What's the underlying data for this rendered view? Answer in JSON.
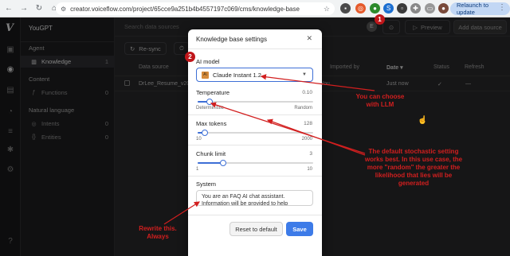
{
  "browser": {
    "url": "creator.voiceflow.com/project/65cce9a251b4b4557197c069/cms/knowledge-base",
    "relaunch_label": "Relaunch to update"
  },
  "sidebar": {
    "title": "YouGPT",
    "sections": [
      {
        "label": "Agent"
      },
      {
        "label": "Content"
      },
      {
        "label": "Natural language"
      }
    ],
    "items": [
      {
        "label": "Knowledge",
        "count": "1"
      },
      {
        "label": "Functions",
        "count": "0"
      },
      {
        "label": "Intents",
        "count": "0"
      },
      {
        "label": "Entities",
        "count": "0"
      }
    ]
  },
  "topbar": {
    "search_placeholder": "Search data sources",
    "avatar_initial": "E",
    "preview_label": "Preview",
    "add_label": "Add data source"
  },
  "toolbar": {
    "resync_label": "Re-sync"
  },
  "table": {
    "headers": [
      "Data source",
      "Imported by",
      "Date",
      "Status",
      "Refresh"
    ],
    "rows": [
      {
        "name": "DrLee_Resume_v202",
        "imported_by": "You",
        "date": "Just now",
        "status": "✓",
        "refresh": "—"
      }
    ]
  },
  "modal": {
    "title": "Knowledge base settings",
    "ai_model_label": "AI model",
    "ai_model_value": "Claude Instant 1.2",
    "temperature": {
      "label": "Temperature",
      "value": "0.10",
      "value_fraction": 0.1,
      "min_label": "Deterministic",
      "max_label": "Random"
    },
    "max_tokens": {
      "label": "Max tokens",
      "value": "128",
      "value_fraction": 0.06,
      "min_label": "10",
      "max_label": "2000"
    },
    "chunk_limit": {
      "label": "Chunk limit",
      "value": "3",
      "value_fraction": 0.22,
      "min_label": "1",
      "max_label": "10"
    },
    "system": {
      "label": "System",
      "text": "You are an FAQ AI chat assistant. Information will be provided to help"
    },
    "reset_label": "Reset to default",
    "save_label": "Save"
  },
  "annotations": {
    "badge_1": "1",
    "badge_2": "2",
    "note_llm": "You can choose with LLM",
    "note_stochastic": "The default stochastic setting works best.  In this use case, the more \"random\" the greater the likelihood that lies will be generated",
    "note_rewrite": "Rewrite this. Always",
    "color": "#d21f1f"
  }
}
